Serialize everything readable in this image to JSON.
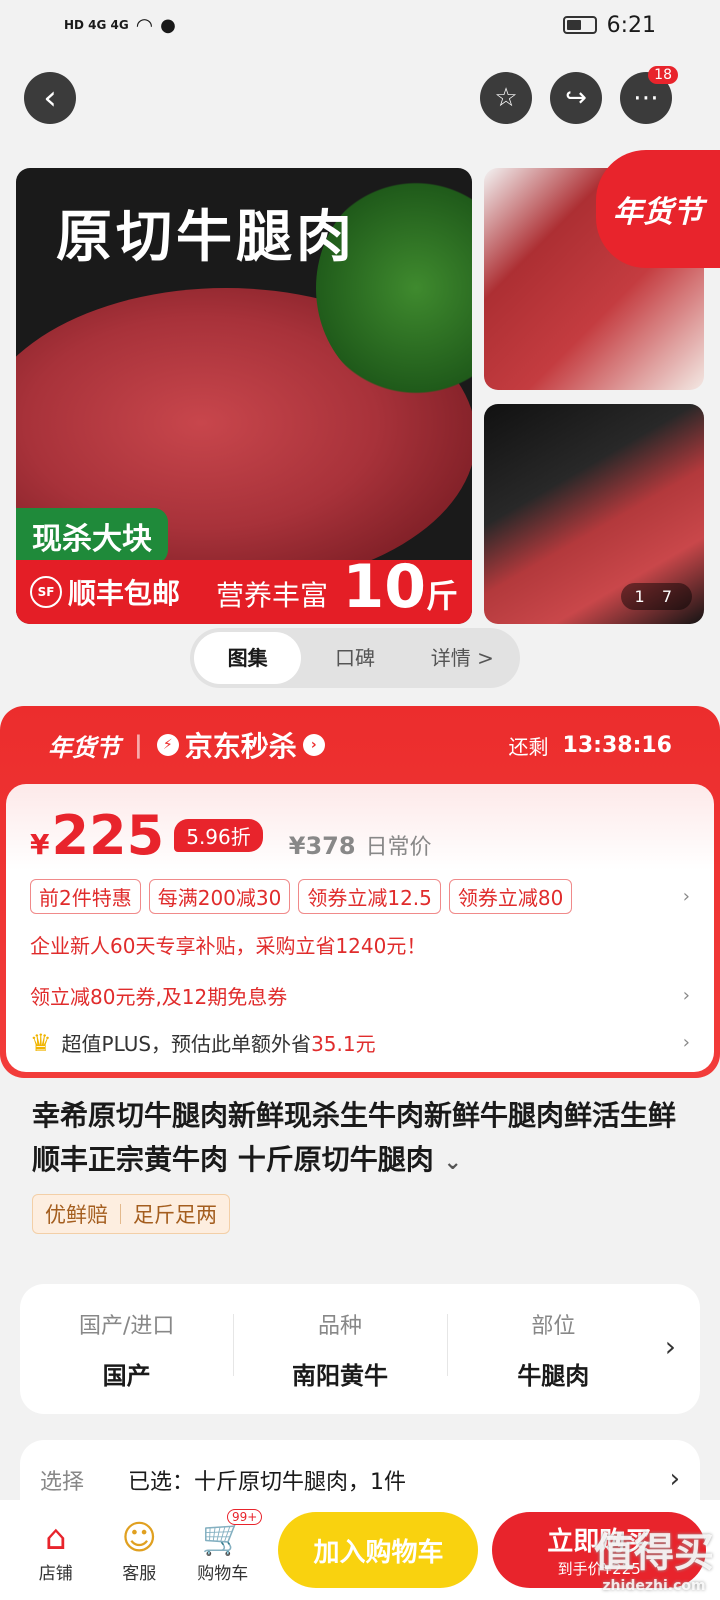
{
  "status_bar": {
    "network": "HD 4G 4G",
    "time": "6:21"
  },
  "top_bar": {
    "back": "‹",
    "favorite": "☆",
    "share": "↪",
    "more": "⋯",
    "more_badge": "18"
  },
  "gallery": {
    "main_title": "原切牛腿肉",
    "green_label": "现杀大块",
    "sf_logo": "SF",
    "sf_text": "顺丰包邮",
    "nutrition": "营养丰富",
    "weight": "10",
    "weight_unit": "斤",
    "festival_tag": "年货节",
    "pager": "1 7"
  },
  "tabs": [
    "图集",
    "口碑",
    "详情 >"
  ],
  "promo": {
    "festival": "年货节",
    "seckill": "京东秒杀",
    "remain_label": "还剩",
    "countdown": "13:38:16",
    "yen": "¥",
    "price": "225",
    "discount": "5.96折",
    "orig_price": "¥378",
    "orig_label": "日常价",
    "coupons": [
      "前2件特惠",
      "每满200减30",
      "领券立减12.5",
      "领券立减80"
    ],
    "enterprise": "企业新人60天专享补贴，采购立省1240元！",
    "coupon_line": "领立减80元券,及12期免息券",
    "plus_prefix": "超值PLUS，预估此单额外省",
    "plus_amount": "35.1元"
  },
  "product": {
    "title": "幸希原切牛腿肉新鲜现杀生牛肉新鲜牛腿肉鲜活生鲜顺丰正宗黄牛肉 十斤原切牛腿肉",
    "expand_icon": "⌄",
    "tags": [
      "优鲜赔",
      "足斤足两"
    ]
  },
  "attributes": [
    {
      "key": "国产/进口",
      "value": "国产"
    },
    {
      "key": "品种",
      "value": "南阳黄牛"
    },
    {
      "key": "部位",
      "value": "牛腿肉"
    }
  ],
  "selection": {
    "label": "选择",
    "value": "已选：十斤原切牛腿肉，1件"
  },
  "bottom_bar": {
    "store": "店铺",
    "service": "客服",
    "cart": "购物车",
    "cart_badge": "99+",
    "add_to_cart": "加入购物车",
    "buy_now": "立即购买",
    "buy_price": "到手价¥225",
    "watermark": "值得买",
    "watermark_site": "zhidezhi.com"
  }
}
